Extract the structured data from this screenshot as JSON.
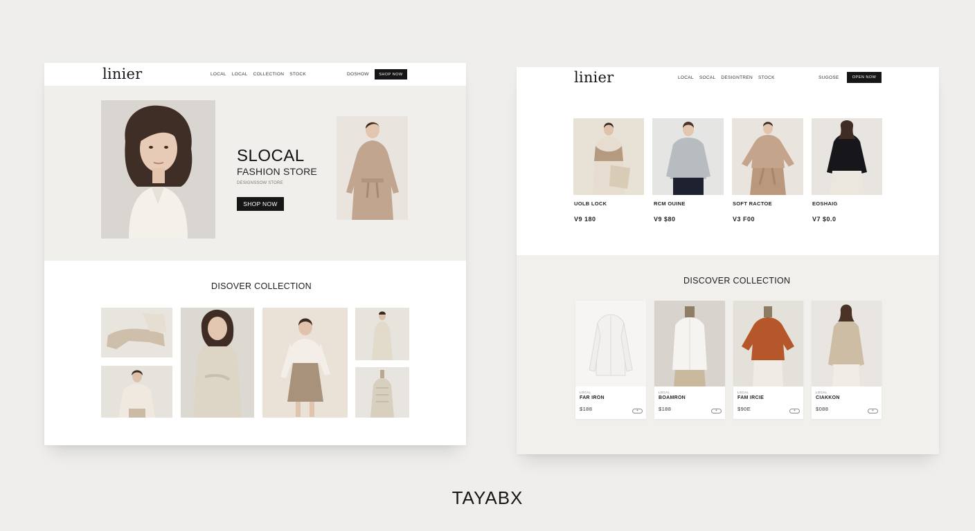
{
  "colors": {
    "background": "#efeeec",
    "panel": "#ffffff",
    "hero_bg": "#f1efeb",
    "right_lower_bg": "#f2f0ec",
    "button": "#161616"
  },
  "left_panel": {
    "nav": {
      "logo": "linier",
      "menu": [
        "LOCAL",
        "LOCAL",
        "COLLECTION",
        "STOCK"
      ],
      "link": "DOSHOW",
      "button": "SHOP NOW"
    },
    "hero": {
      "title": "SLOCAL",
      "subtitle": "FASHION STORE",
      "tagline": "DESIGNSSOW STORE",
      "cta": "SHOP NOW"
    },
    "collection": {
      "title": "DISOVER COLLECTION"
    }
  },
  "right_panel": {
    "nav": {
      "logo": "linier",
      "menu": [
        "LOCAL",
        "SOCAL",
        "DESIGNTREN",
        "STOCK"
      ],
      "link": "SUGOSE",
      "button": "OPEN NOW"
    },
    "products": [
      {
        "name": "UOLB LOCK",
        "price": "V9 180"
      },
      {
        "name": "RCM OUINE",
        "price": "V9 $80"
      },
      {
        "name": "SOFT RACTOE",
        "price": "V3 F00"
      },
      {
        "name": "EOSHAIG",
        "price": "V7 $0.0"
      }
    ],
    "collection": {
      "title": "DISCOVER COLLECTION",
      "cards": [
        {
          "tag": "LOCAL",
          "name": "FAR IRON",
          "price": "$188",
          "pill": "+"
        },
        {
          "tag": "LOCAL",
          "name": "BOAMRON",
          "price": "$188",
          "pill": "+"
        },
        {
          "tag": "LOCAL",
          "name": "FAM IRCIE",
          "price": "$90E",
          "pill": "+"
        },
        {
          "tag": "LOCAL",
          "name": "CIAKKON",
          "price": "$088",
          "pill": "+"
        }
      ]
    }
  },
  "brand": "TAYABX"
}
